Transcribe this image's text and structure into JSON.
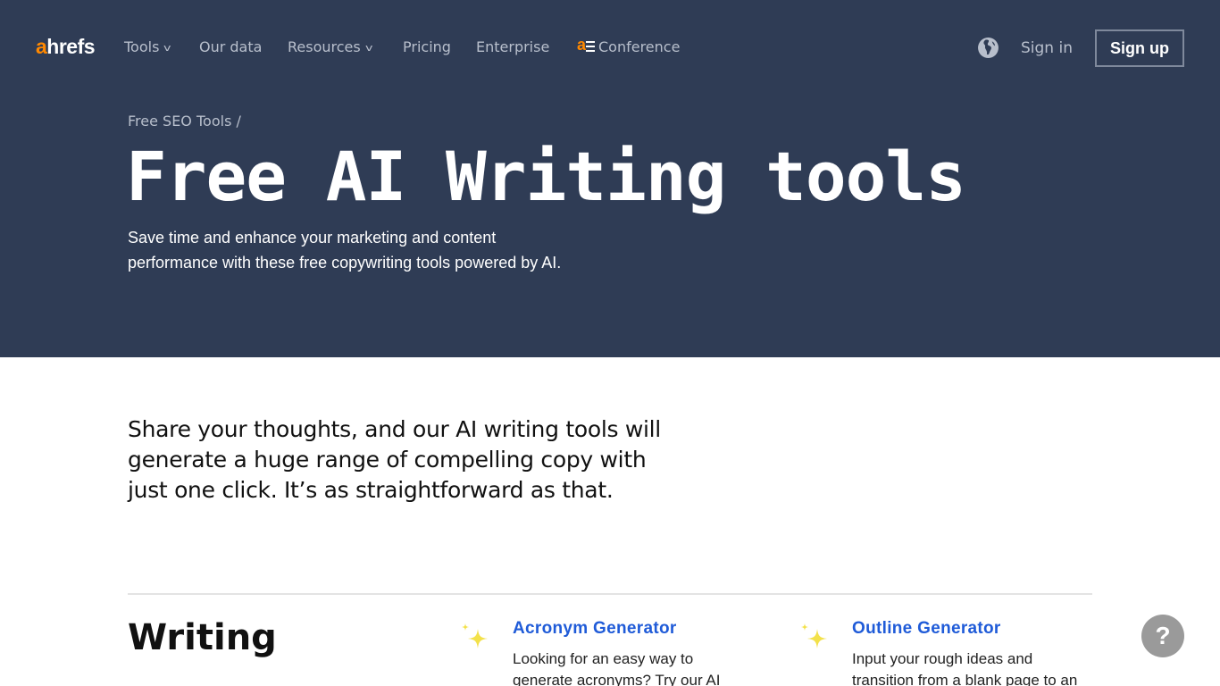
{
  "nav": {
    "logo_accent": "a",
    "logo_rest": "hrefs",
    "items": [
      {
        "label": "Tools",
        "has_dropdown": true
      },
      {
        "label": "Our data",
        "has_dropdown": false
      },
      {
        "label": "Resources",
        "has_dropdown": true
      },
      {
        "label": "Pricing",
        "has_dropdown": false
      },
      {
        "label": "Enterprise",
        "has_dropdown": false
      },
      {
        "label": "Conference",
        "has_dropdown": false
      }
    ],
    "chevron_glyph": "v",
    "globe_icon": "globe-icon",
    "signin_label": "Sign in",
    "signup_label": "Sign up"
  },
  "hero": {
    "breadcrumb": "Free SEO Tools /",
    "title": "Free AI Writing tools",
    "description": "Save time and enhance your marketing and content performance with these free copywriting tools powered by AI."
  },
  "intro": {
    "text": "Share your thoughts, and our AI writing tools will generate a huge range of compelling copy with just one click. It’s as straightforward as that."
  },
  "section": {
    "title": "Writing",
    "tools": [
      {
        "name": "Acronym Generator",
        "description": "Looking for an easy way to generate acronyms? Try our AI",
        "icon": "sparkles-icon"
      },
      {
        "name": "Outline Generator",
        "description": "Input your rough ideas and transition from a blank page to an",
        "icon": "sparkles-icon"
      }
    ]
  },
  "help": {
    "label": "?"
  },
  "colors": {
    "hero_bg": "#2f3c55",
    "brand_orange": "#ff8800",
    "link_blue": "#1f5bd8",
    "sparkle_yellow": "#f3e14a"
  }
}
